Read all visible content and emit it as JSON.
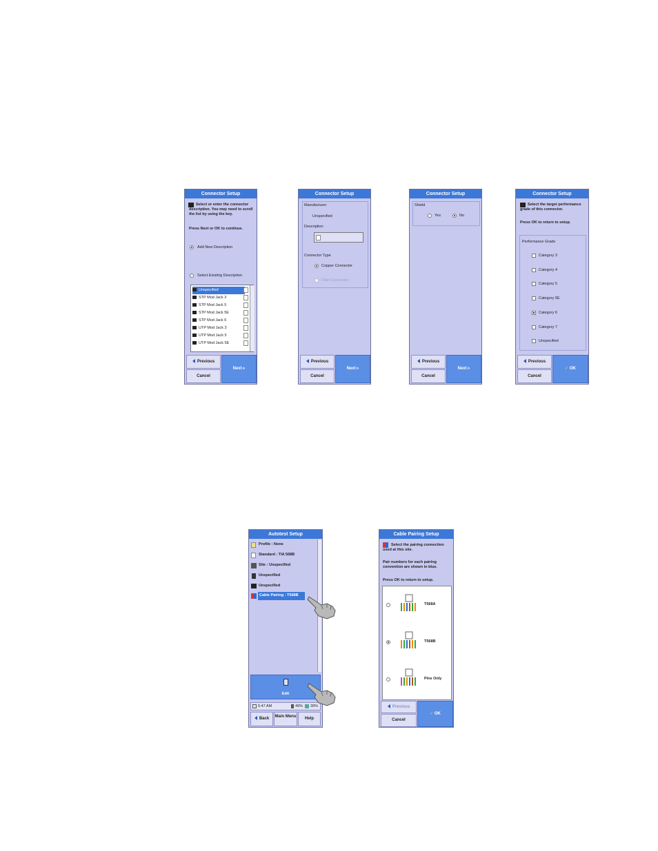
{
  "top_screens": {
    "s1": {
      "title": "Connector Setup",
      "instruction": "Select or enter the connector description. You may need to scroll the list by using the key.",
      "press_line": "Press Next or OK to continue.",
      "add_new": "Add New Description",
      "select_existing": "Select Existing Description",
      "list": [
        "Unspecified",
        "STP Mod Jack 3",
        "STP Mod Jack 5",
        "STP Mod Jack 5E",
        "STP Mod Jack 6",
        "UTP Mod Jack 3",
        "UTP Mod Jack 5",
        "UTP Mod Jack 5E"
      ],
      "previous": "Previous",
      "cancel": "Cancel",
      "next": "Next"
    },
    "s2": {
      "title": "Connector Setup",
      "manufacturer_label": "Manufacturer",
      "manufacturer_value": "Unspecified",
      "description_label": "Description",
      "connector_type_label": "Connector Type",
      "copper": "Copper Connector",
      "fiber": "Fiber Connector",
      "previous": "Previous",
      "cancel": "Cancel",
      "next": "Next"
    },
    "s3": {
      "title": "Connector Setup",
      "shield_label": "Shield",
      "yes": "Yes",
      "no": "No",
      "previous": "Previous",
      "cancel": "Cancel",
      "next": "Next"
    },
    "s4": {
      "title": "Connector Setup",
      "instruction": "Select the target performance grade of this connector.",
      "press_line": "Press OK to return to setup.",
      "grade_label": "Performance Grade",
      "grades": [
        "Category 3",
        "Category 4",
        "Category 5",
        "Category 5E",
        "Category 6",
        "Category 7",
        "Unspecified"
      ],
      "selected_grade": "Category 6",
      "previous": "Previous",
      "cancel": "Cancel",
      "ok": "OK"
    }
  },
  "bottom_screens": {
    "autotest": {
      "title": "Autotest Setup",
      "items": [
        "Profile : None",
        "Standard : TIA 568B",
        "Site : Unspecified",
        "Unspecified",
        "Unspecified",
        "Cable Pairing : T568B"
      ],
      "edit": "Edit",
      "time": "5:47 AM",
      "status1": "49%",
      "status2": "39%",
      "back": "Back",
      "main_menu": "Main Menu",
      "help": "Help"
    },
    "pairing": {
      "title": "Cable Pairing Setup",
      "instruction": "Select the pairing connection used at this site.",
      "pair_note": "Pair numbers for each pairing convention are shown in blue.",
      "press_line": "Press OK to return to setup.",
      "options": [
        "T568A",
        "T568B",
        "Pins Only"
      ],
      "selected": "T568B",
      "previous": "Previous",
      "cancel": "Cancel",
      "ok": "OK"
    }
  },
  "colors": {
    "screen_bg": "#c7c9ef",
    "title_bar": "#3c78d8",
    "primary_button": "#5b8fe6"
  }
}
